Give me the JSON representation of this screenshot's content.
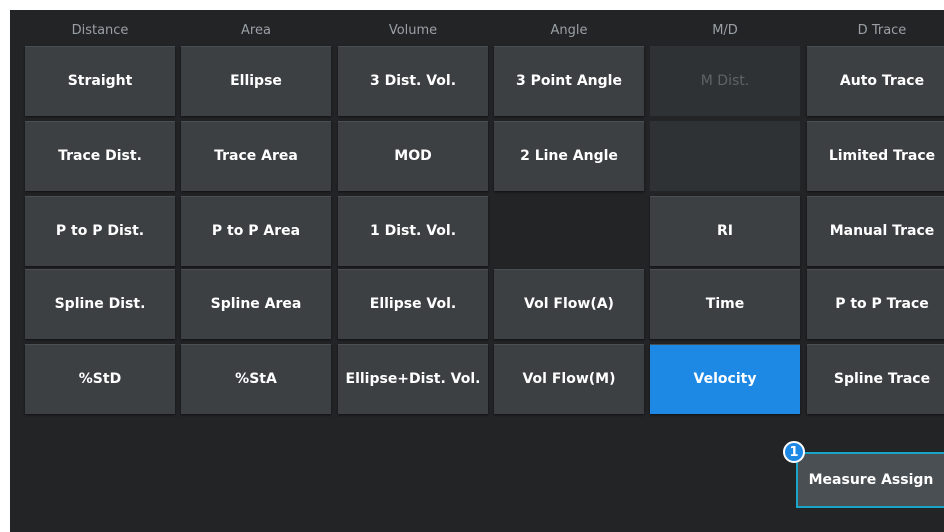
{
  "columns": [
    "Distance",
    "Area",
    "Volume",
    "Angle",
    "M/D",
    "D Trace"
  ],
  "grid": [
    [
      "Straight",
      "Ellipse",
      "3 Dist. Vol.",
      "3 Point Angle",
      "M Dist.",
      "Auto Trace"
    ],
    [
      "Trace Dist.",
      "Trace Area",
      "MOD",
      "2 Line Angle",
      "",
      "Limited Trace"
    ],
    [
      "P to P Dist.",
      "P to P Area",
      "1 Dist. Vol.",
      "",
      "RI",
      "Manual Trace"
    ],
    [
      "Spline Dist.",
      "Spline Area",
      "Ellipse Vol.",
      "Vol Flow(A)",
      "Time",
      "P to P Trace"
    ],
    [
      "%StD",
      "%StA",
      "Ellipse+Dist. Vol.",
      "Vol Flow(M)",
      "Velocity",
      "Spline Trace"
    ]
  ],
  "selected": "Velocity",
  "disabled": [
    "M Dist."
  ],
  "assign_button": {
    "label": "Measure Assign",
    "badge": "1"
  },
  "colors": {
    "selected": "#1e88e5",
    "button": "#3c4043",
    "background": "#222426"
  }
}
